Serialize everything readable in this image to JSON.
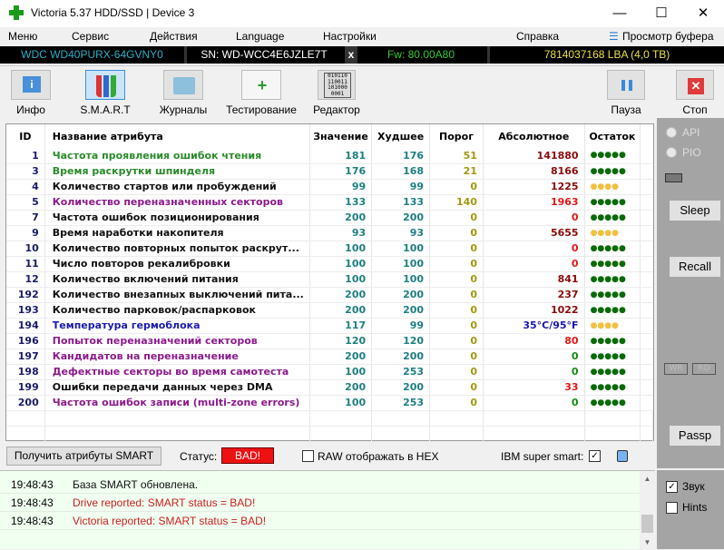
{
  "window": {
    "title": "Victoria 5.37 HDD/SSD | Device 3",
    "minimize": "—",
    "maximize": "☐",
    "close": "✕"
  },
  "menu": {
    "items": [
      "Меню",
      "Сервис",
      "Действия",
      "Language",
      "Настройки",
      "Справка"
    ],
    "buffer_view": "Просмотр буфера"
  },
  "device": {
    "model": "WDC WD40PURX-64GVNY0",
    "serial": "SN: WD-WCC4E6JZLE7T",
    "close": "x",
    "firmware": "Fw: 80.00A80",
    "capacity": "7814037168 LBA (4,0 TB)"
  },
  "toolbar": {
    "info": "Инфо",
    "smart": "S.M.A.R.T",
    "logs": "Журналы",
    "test": "Тестирование",
    "editor": "Редактор",
    "editor_icon_text": "010110 110011 101000 0001",
    "pause": "Пауза",
    "stop": "Стоп"
  },
  "table": {
    "headers": [
      "ID",
      "Название атрибута",
      "Значение",
      "Худшее",
      "Порог",
      "Абсолютное",
      "Остаток"
    ],
    "colors": {
      "green": "#2a8a2a",
      "black": "#111111",
      "purple": "#8b1a8b",
      "blue": "#1a1ab0",
      "value": "#1f7f7f",
      "threshold": "#a09a10",
      "raw_dark": "#8b0a0a",
      "raw_red": "#e01818",
      "raw_green": "#138a13",
      "dot_green": "#0a6a0a",
      "dot_yellow": "#f0c040"
    },
    "rows": [
      {
        "id": "1",
        "name": "Частота проявления ошибок чтения",
        "nc": "green",
        "value": "181",
        "worst": "176",
        "threshold": "51",
        "raw": "141880",
        "rc": "raw_dark",
        "rem": 5
      },
      {
        "id": "3",
        "name": "Время раскрутки шпинделя",
        "nc": "green",
        "value": "176",
        "worst": "168",
        "threshold": "21",
        "raw": "8166",
        "rc": "raw_dark",
        "rem": 5
      },
      {
        "id": "4",
        "name": "Количество стартов или пробуждений",
        "nc": "black",
        "value": "99",
        "worst": "99",
        "threshold": "0",
        "raw": "1225",
        "rc": "raw_dark",
        "rem": 4
      },
      {
        "id": "5",
        "name": "Количество переназначенных секторов",
        "nc": "purple",
        "value": "133",
        "worst": "133",
        "threshold": "140",
        "raw": "1963",
        "rc": "raw_red",
        "rem": 5
      },
      {
        "id": "7",
        "name": "Частота ошибок позиционирования",
        "nc": "black",
        "value": "200",
        "worst": "200",
        "threshold": "0",
        "raw": "0",
        "rc": "raw_red",
        "rem": 5
      },
      {
        "id": "9",
        "name": "Время наработки накопителя",
        "nc": "black",
        "value": "93",
        "worst": "93",
        "threshold": "0",
        "raw": "5655",
        "rc": "raw_dark",
        "rem": 4
      },
      {
        "id": "10",
        "name": "Количество повторных попыток раскрут...",
        "nc": "black",
        "value": "100",
        "worst": "100",
        "threshold": "0",
        "raw": "0",
        "rc": "raw_red",
        "rem": 5
      },
      {
        "id": "11",
        "name": "Число повторов рекалибровки",
        "nc": "black",
        "value": "100",
        "worst": "100",
        "threshold": "0",
        "raw": "0",
        "rc": "raw_red",
        "rem": 5
      },
      {
        "id": "12",
        "name": "Количество включений питания",
        "nc": "black",
        "value": "100",
        "worst": "100",
        "threshold": "0",
        "raw": "841",
        "rc": "raw_dark",
        "rem": 5
      },
      {
        "id": "192",
        "name": "Количество внезапных выключений пита...",
        "nc": "black",
        "value": "200",
        "worst": "200",
        "threshold": "0",
        "raw": "237",
        "rc": "raw_dark",
        "rem": 5
      },
      {
        "id": "193",
        "name": "Количество парковок/распарковок",
        "nc": "black",
        "value": "200",
        "worst": "200",
        "threshold": "0",
        "raw": "1022",
        "rc": "raw_dark",
        "rem": 5
      },
      {
        "id": "194",
        "name": "Температура гермоблока",
        "nc": "blue",
        "value": "117",
        "worst": "99",
        "threshold": "0",
        "raw": "35°C/95°F",
        "rc": "blue",
        "rem": 4
      },
      {
        "id": "196",
        "name": "Попыток переназначений секторов",
        "nc": "purple",
        "value": "120",
        "worst": "120",
        "threshold": "0",
        "raw": "80",
        "rc": "raw_red",
        "rem": 5
      },
      {
        "id": "197",
        "name": "Кандидатов на переназначение",
        "nc": "purple",
        "value": "200",
        "worst": "200",
        "threshold": "0",
        "raw": "0",
        "rc": "raw_green",
        "rem": 5
      },
      {
        "id": "198",
        "name": "Дефектные секторы во время самотеста",
        "nc": "purple",
        "value": "100",
        "worst": "253",
        "threshold": "0",
        "raw": "0",
        "rc": "raw_green",
        "rem": 5
      },
      {
        "id": "199",
        "name": "Ошибки передачи данных через DMA",
        "nc": "black",
        "value": "200",
        "worst": "200",
        "threshold": "0",
        "raw": "33",
        "rc": "raw_red",
        "rem": 5
      },
      {
        "id": "200",
        "name": "Частота ошибок записи (multi-zone errors)",
        "nc": "purple",
        "value": "100",
        "worst": "253",
        "threshold": "0",
        "raw": "0",
        "rc": "raw_green",
        "rem": 5
      }
    ]
  },
  "side": {
    "api": "API",
    "pio": "PIO",
    "sleep": "Sleep",
    "recall": "Recall",
    "wr": "WR",
    "rd": "RD",
    "passp": "Passp"
  },
  "bottom": {
    "get_smart": "Получить атрибуты SMART",
    "status_label": "Статус:",
    "status": "BAD!",
    "status_color": "#ee1111",
    "raw_hex": "RAW отображать в HEX",
    "raw_hex_checked": false,
    "ibm": "IBM super smart:",
    "ibm_checked": true
  },
  "log": [
    {
      "time": "19:48:43",
      "text": "База SMART обновлена.",
      "color": "#111111"
    },
    {
      "time": "19:48:43",
      "text": "Drive reported: SMART status = BAD!",
      "color": "#cc2020"
    },
    {
      "time": "19:48:43",
      "text": "Victoria reported: SMART status = BAD!",
      "color": "#cc2020"
    }
  ],
  "log_options": {
    "sound": "Звук",
    "sound_checked": true,
    "hints": "Hints",
    "hints_checked": false
  }
}
